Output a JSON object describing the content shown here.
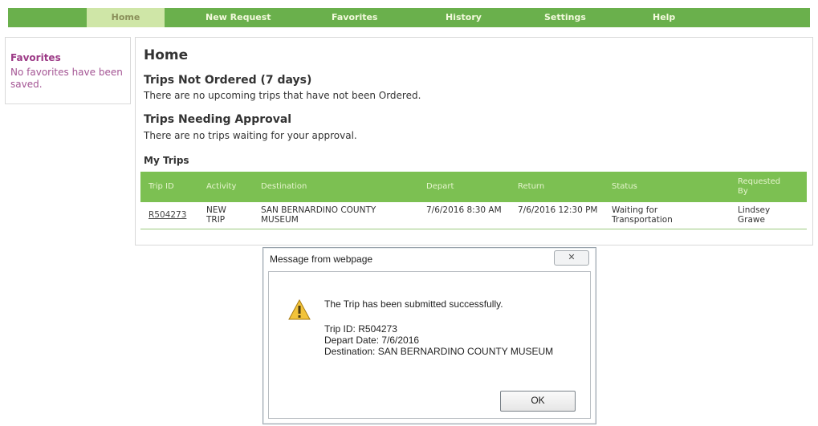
{
  "nav": {
    "items": [
      {
        "label": "Home",
        "active": true
      },
      {
        "label": "New Request"
      },
      {
        "label": "Favorites"
      },
      {
        "label": "History"
      },
      {
        "label": "Settings"
      },
      {
        "label": "Help"
      }
    ]
  },
  "sidebar": {
    "title": "Favorites",
    "text": "No favorites have been saved."
  },
  "main": {
    "title": "Home",
    "not_ordered": {
      "title": "Trips Not Ordered (7 days)",
      "text": "There are no upcoming trips that have not been Ordered."
    },
    "needing_approval": {
      "title": "Trips Needing Approval",
      "text": "There are no trips waiting for your approval."
    },
    "my_trips": {
      "title": "My Trips",
      "columns": [
        "Trip ID",
        "Activity",
        "Destination",
        "Depart",
        "Return",
        "Status",
        "Requested By"
      ],
      "rows": [
        {
          "trip_id": "R504273",
          "activity": "NEW TRIP",
          "destination": "SAN BERNARDINO COUNTY MUSEUM",
          "depart": "7/6/2016 8:30 AM",
          "return": "7/6/2016 12:30 PM",
          "status": "Waiting for Transportation",
          "requested_by": "Lindsey Grawe"
        }
      ]
    }
  },
  "dialog": {
    "title": "Message from webpage",
    "close_label": "✕",
    "message": "The Trip has been submitted successfully.",
    "details": {
      "trip_id": "Trip ID: R504273",
      "depart_date": "Depart Date: 7/6/2016",
      "destination": "Destination: SAN BERNARDINO COUNTY MUSEUM"
    },
    "ok_label": "OK",
    "icon": "warning-icon"
  },
  "colors": {
    "nav_green": "#6ab04c",
    "nav_active": "#cfe6a7",
    "table_header": "#7cc052",
    "sidebar_purple": "#9c3a86"
  }
}
